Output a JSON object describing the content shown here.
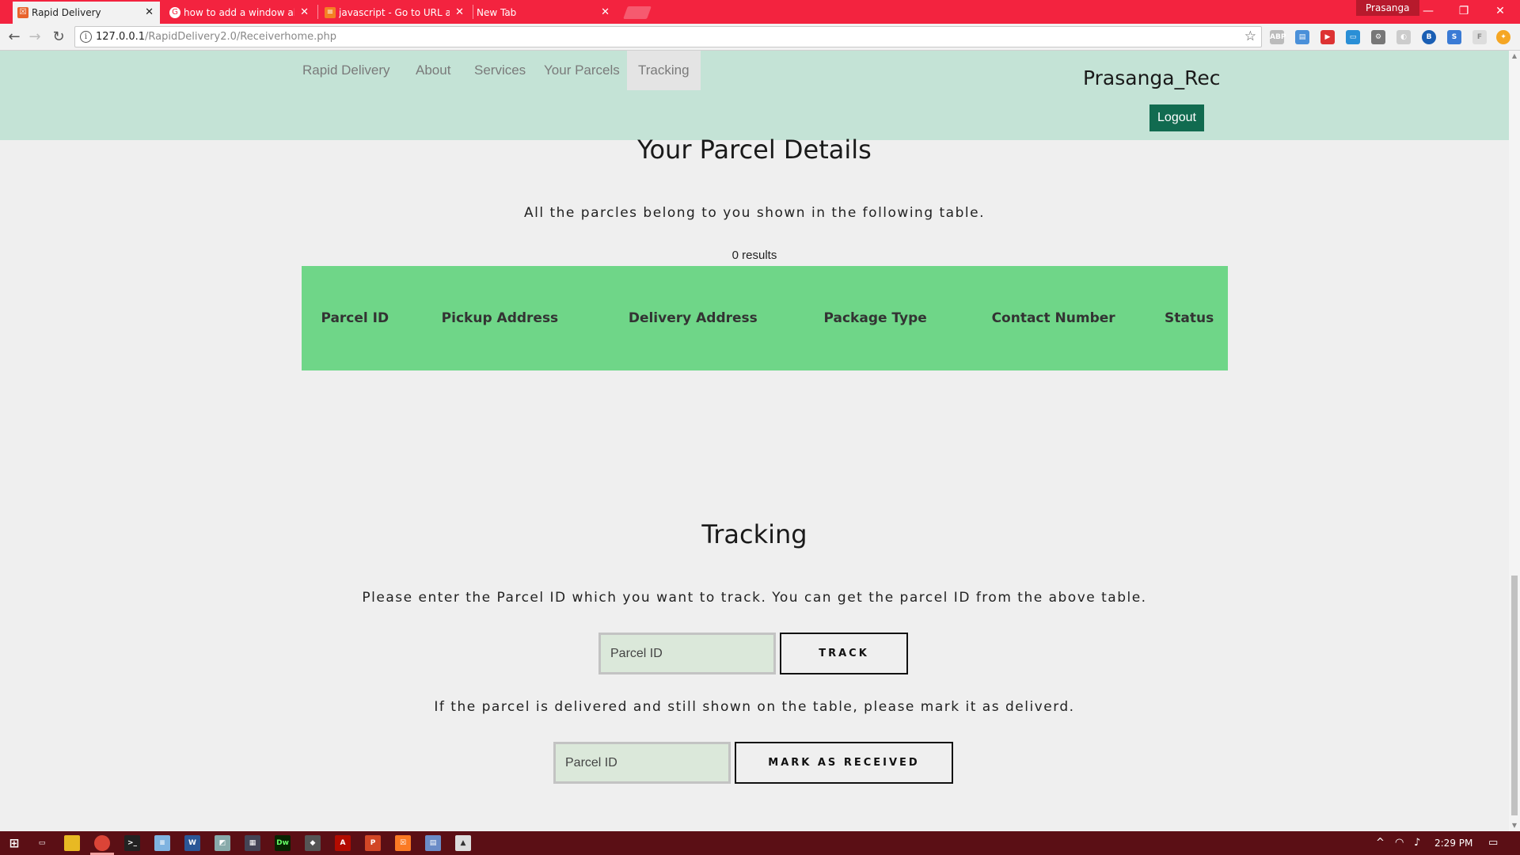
{
  "browser": {
    "tabs": [
      {
        "title": "Rapid Delivery",
        "favicon_color": "#e8632b"
      },
      {
        "title": "how to add a window ale",
        "favicon_color": "#ffffff"
      },
      {
        "title": "javascript - Go to URL af",
        "favicon_color": "#f48024"
      },
      {
        "title": "New Tab",
        "favicon_color": "#f3233f"
      }
    ],
    "profile": "Prasanga",
    "url_host": "127.0.0.1",
    "url_path": "/RapidDelivery2.0/Receiverhome.php",
    "accent_color": "#f3233f"
  },
  "site_nav": {
    "brand": "Rapid Delivery",
    "links": [
      "About",
      "Services",
      "Your Parcels",
      "Tracking"
    ],
    "active_link": "Tracking",
    "username": "Prasanga_Rec",
    "logout_label": "Logout",
    "background_color": "#c4e3d6"
  },
  "parcels": {
    "title": "Your Parcel Details",
    "subtitle": "All the parcles belong to you shown in the following table.",
    "result_count": "0 results",
    "columns": [
      "Parcel ID",
      "Pickup Address",
      "Delivery Address",
      "Package Type",
      "Contact Number",
      "Status"
    ],
    "rows": [],
    "header_color": "#6fd688"
  },
  "tracking": {
    "title": "Tracking",
    "instruction": "Please enter the Parcel ID which you want to track. You can get the parcel ID from the above table.",
    "track_placeholder": "Parcel ID",
    "track_button": "TRACK",
    "mark_instruction": "If the parcel is delivered and still shown on the table, please mark it as deliverd.",
    "mark_placeholder": "Parcel ID",
    "mark_button": "MARK AS RECEIVED"
  },
  "taskbar": {
    "time": "2:29 PM",
    "color": "#5b0f15"
  }
}
